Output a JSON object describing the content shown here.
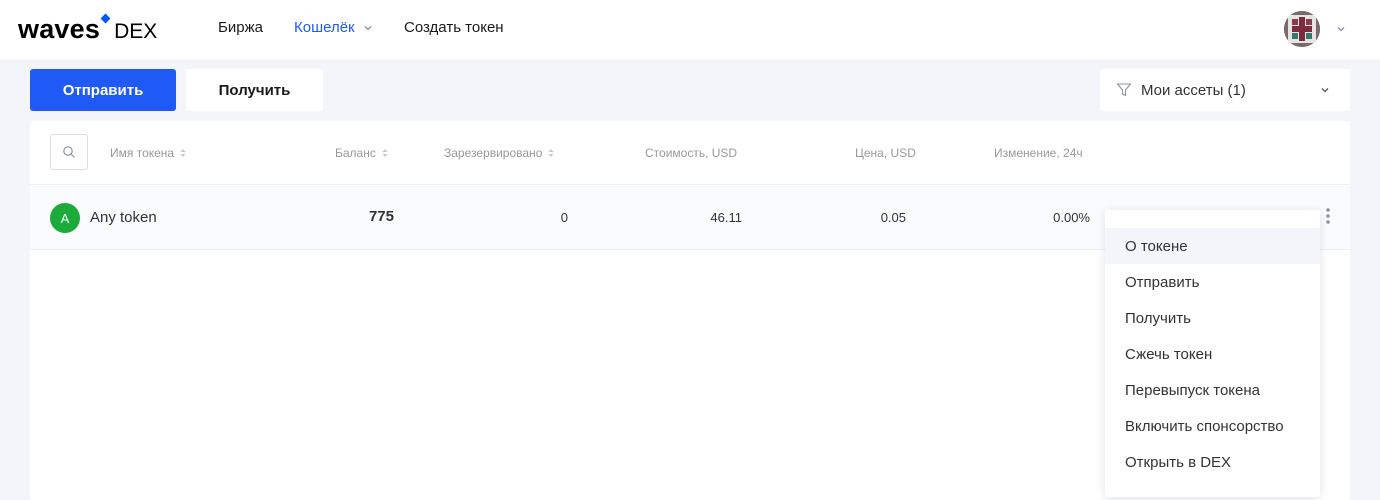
{
  "header": {
    "logo_word": "waves",
    "logo_suffix": "DEX",
    "nav": [
      {
        "label": "Биржа"
      },
      {
        "label": "Кошелёк"
      },
      {
        "label": "Создать токен"
      }
    ]
  },
  "actions": {
    "send_label": "Отправить",
    "receive_label": "Получить"
  },
  "filter": {
    "label": "Мои ассеты (1)"
  },
  "table": {
    "columns": {
      "name": "Имя токена",
      "balance": "Баланс",
      "reserved": "Зарезервировано",
      "value_usd": "Стоимость, USD",
      "price_usd": "Цена, USD",
      "change_24h": "Изменение, 24ч"
    },
    "rows": [
      {
        "icon_letter": "A",
        "name": "Any token",
        "balance": "775",
        "reserved": "0",
        "value_usd": "46.11",
        "price_usd": "0.05",
        "change_24h": "0.00%"
      }
    ]
  },
  "context_menu": {
    "items": [
      {
        "label": "О токене"
      },
      {
        "label": "Отправить"
      },
      {
        "label": "Получить"
      },
      {
        "label": "Сжечь токен"
      },
      {
        "label": "Перевыпуск токена"
      },
      {
        "label": "Включить спонсорство"
      },
      {
        "label": "Открыть в DEX"
      }
    ]
  },
  "colors": {
    "accent": "#1f5af6",
    "logo_diamond": "#0055ff",
    "token_icon": "#1aab3b",
    "page_bg": "#f3f5fb"
  },
  "icons": [
    "chevron-down-icon",
    "avatar",
    "filter-icon",
    "search-icon",
    "sort-icon",
    "kebab-menu-icon"
  ]
}
